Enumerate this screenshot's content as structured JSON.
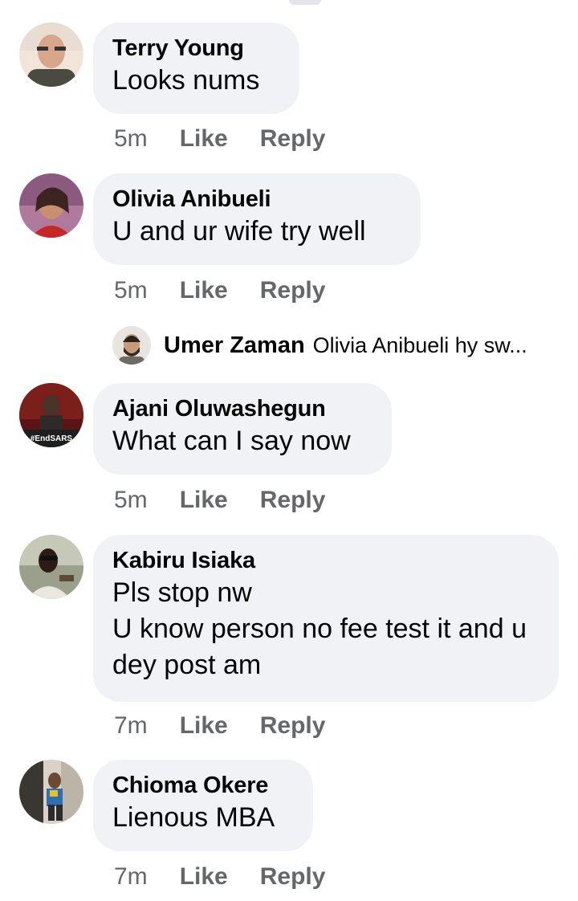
{
  "comments": [
    {
      "name": "Terry Young",
      "text": "Looks nums",
      "time": "5m",
      "like": "Like",
      "reply": "Reply",
      "avatar_icon": "user-avatar-terry"
    },
    {
      "name": "Olivia Anibueli",
      "text": "U and ur wife try well",
      "time": "5m",
      "like": "Like",
      "reply": "Reply",
      "avatar_icon": "user-avatar-olivia"
    },
    {
      "name": "Ajani Oluwashegun",
      "text": "What can I say now",
      "time": "5m",
      "like": "Like",
      "reply": "Reply",
      "avatar_icon": "user-avatar-ajani",
      "avatar_tag": "#EndSARS"
    },
    {
      "name": "Kabiru Isiaka",
      "text": "Pls stop nw\nU know person no fee test it and u dey post am",
      "time": "7m",
      "like": "Like",
      "reply": "Reply",
      "avatar_icon": "user-avatar-kabiru"
    },
    {
      "name": "Chioma Okere",
      "text": "Lienous MBA",
      "time": "7m",
      "like": "Like",
      "reply": "Reply",
      "avatar_icon": "user-avatar-chioma"
    }
  ],
  "reply_preview": {
    "name": "Umer Zaman",
    "text": "Olivia Anibueli hy sw...",
    "avatar_icon": "user-avatar-umer"
  }
}
